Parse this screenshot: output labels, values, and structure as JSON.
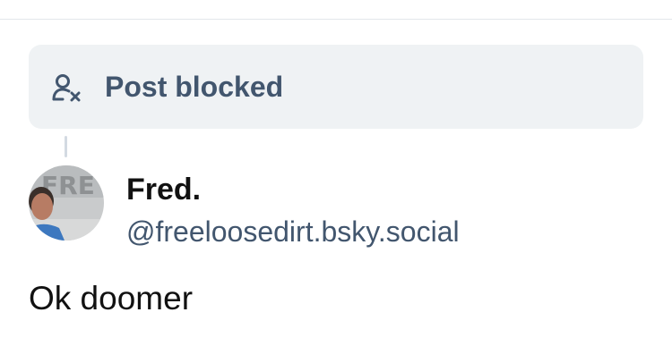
{
  "banner": {
    "icon": "person-x-icon",
    "label": "Post blocked"
  },
  "post": {
    "author": {
      "display_name": "Fred.",
      "handle": "@freeloosedirt.bsky.social",
      "avatar_text": "FRE"
    },
    "text": "Ok doomer"
  },
  "colors": {
    "banner_bg": "#eff2f4",
    "muted_text": "#42566e",
    "primary_text": "#111111",
    "thread_line": "#d3dae2"
  }
}
